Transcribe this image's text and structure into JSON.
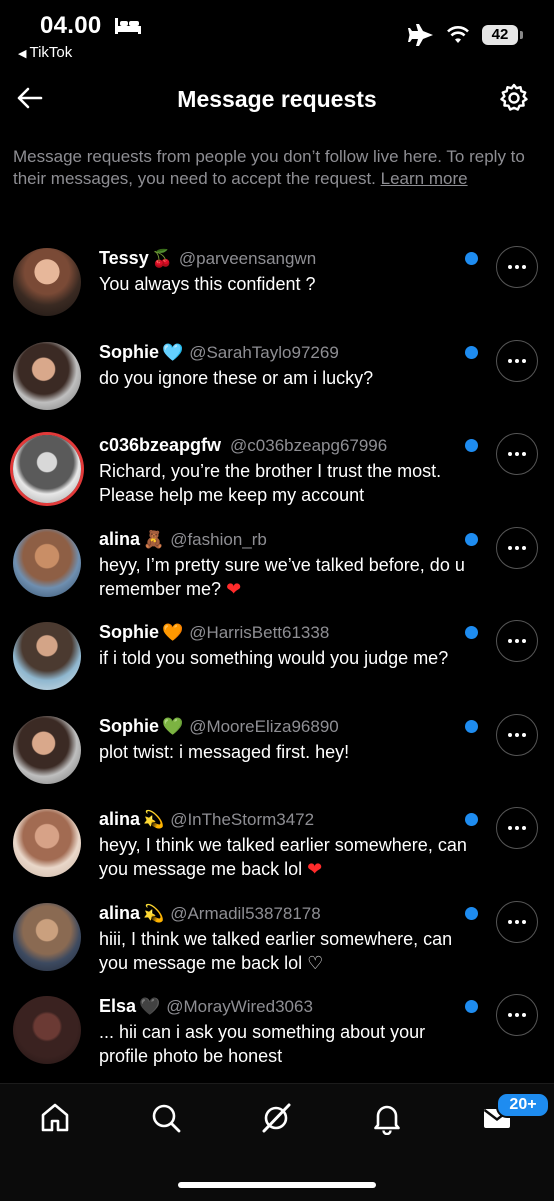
{
  "status_bar": {
    "time": "04.00",
    "back_app": "TikTok",
    "battery": "42"
  },
  "header": {
    "title": "Message requests"
  },
  "intro": {
    "text": "Message requests from people you don’t follow live here. To reply to their messages, you need to accept the request.",
    "link": "Learn more"
  },
  "requests": [
    {
      "name": "Tessy",
      "emoji": "🍒",
      "handle": "@parveensangwn",
      "message": "You always this confident ?",
      "heart": ""
    },
    {
      "name": "Sophie",
      "emoji": "🩵",
      "handle": "@SarahTaylo97269",
      "message": "do you ignore these or am i lucky?",
      "heart": ""
    },
    {
      "name": "c036bzeapgfw",
      "emoji": "",
      "handle": "@c036bzeapg67996",
      "message": "Richard, you’re the brother I trust the most. Please help me keep my account",
      "heart": ""
    },
    {
      "name": "alina",
      "emoji": "🧸",
      "handle": "@fashion_rb",
      "message": "heyy, I’m pretty sure we’ve talked before, do u remember me?",
      "heart": "❤"
    },
    {
      "name": "Sophie",
      "emoji": "🧡",
      "handle": "@HarrisBett61338",
      "message": "if i told you something would you judge me?",
      "heart": ""
    },
    {
      "name": "Sophie",
      "emoji": "💚",
      "handle": "@MooreEliza96890",
      "message": "plot twist: i messaged first. hey!",
      "heart": ""
    },
    {
      "name": "alina",
      "emoji": "💫",
      "handle": "@InTheStorm3472",
      "message": "heyy, I think we talked earlier somewhere, can you message me back lol",
      "heart": "❤"
    },
    {
      "name": "alina",
      "emoji": "💫",
      "handle": "@Armadil53878178",
      "message": "hiii, I think we talked earlier somewhere, can you message me back lol",
      "heart": "♡"
    },
    {
      "name": "Elsa",
      "emoji": "🖤",
      "handle": "@MorayWired3063",
      "message": "... hii can i ask you something about your profile photo be honest",
      "heart": ""
    }
  ],
  "bottom_nav": {
    "messages_badge": "20+"
  },
  "colors": {
    "accent": "#1e8cf0",
    "background": "#000000",
    "muted_text": "#8e8e93"
  }
}
